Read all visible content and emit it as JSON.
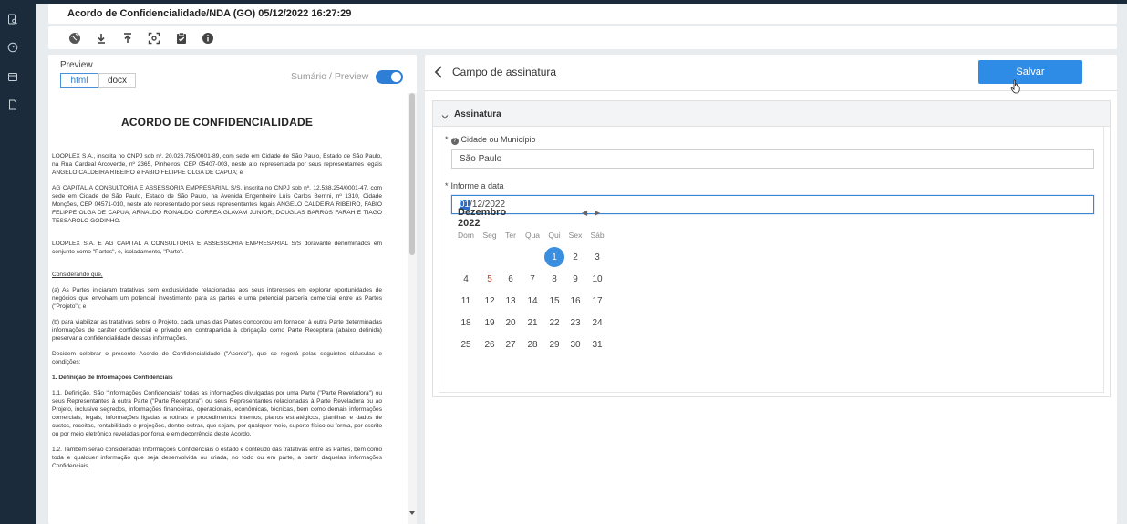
{
  "document": {
    "title": "Acordo de Confidencialidade/NDA (GO) 05/12/2022 16:27:29"
  },
  "toolbar": {
    "icons": [
      "globe-icon",
      "download-icon",
      "upload-icon",
      "scan-icon",
      "clipboard-check-icon",
      "info-icon"
    ]
  },
  "preview": {
    "label": "Preview",
    "tabs": [
      {
        "label": "html",
        "active": true
      },
      {
        "label": "docx",
        "active": false
      }
    ],
    "toggle_label": "Sumário / Preview",
    "toggle_on": true,
    "heading": "ACORDO DE CONFIDENCIALIDADE",
    "paragraphs": {
      "p1": "LOOPLEX S.A., inscrita no CNPJ sob nº. 20.026.785/0001-89, com sede em Cidade de São Paulo, Estado de São Paulo, na Rua Cardeal Arcoverde, nº 2365, Pinheiros, CEP 05407-003, neste ato representada por seus representantes legais ANGELO CALDEIRA RIBEIRO e FABIO FELIPPE OLGA DE CAPUA; e",
      "p2": "AG CAPITAL A CONSULTORIA E ASSESSORIA EMPRESARIAL S/S, inscrita no CNPJ sob nº. 12.538.254/0001-47, com sede em Cidade de São Paulo, Estado de São Paulo, na Avenida Engenheiro Luís Carlos Berrini, nº 1310, Cidade Monções, CEP 04571-010, neste ato representado por seus representantes legais ANGELO CALDEIRA RIBEIRO, FABIO FELIPPE OLGA DE CAPUA, ARNALDO RONALDO CORREA GLAVAM JUNIOR, DOUGLAS BARROS FARAH E TIAGO TESSAROLO GODINHO.",
      "p3": "LOOPLEX S.A. E AG CAPITAL A CONSULTORIA E ASSESSORIA EMPRESARIAL S/S doravante denominados em conjunto como \"Partes\", e, isoladamente, \"Parte\".",
      "p4": "Considerando que,",
      "p5": "(a) As Partes iniciaram tratativas sem exclusividade relacionadas aos seus interesses em explorar oportunidades de negócios que envolvam um potencial investimento para as partes e uma potencial parceria comercial entre as Partes (\"Projeto\"); e",
      "p6": "(b) para viabilizar as tratativas sobre o Projeto, cada umas das Partes concordou em fornecer à outra Parte determinadas informações de caráter confidencial e privado em contrapartida à obrigação como Parte Receptora (abaixo definida) preservar a confidencialidade dessas informações.",
      "p7": "Decidem celebrar o presente Acordo de Confidencialidade (\"Acordo\"), que se regerá pelas seguintes cláusulas e condições:",
      "p8": "1. Definição de Informações Confidenciais",
      "p9": "1.1.   Definição. São \"Informações Confidenciais\" todas as informações divulgadas por uma Parte (\"Parte Reveladora\") ou seus Representantes à outra Parte (\"Parte Receptora\") ou seus Representantes relacionadas à Parte Reveladora ou ao Projeto, inclusive segredos, informações financeiras, operacionais, econômicas, técnicas, bem como demais informações comerciais, legais, informações ligadas a rotinas e procedimentos internos, planos estratégicos, planilhas e dados de custos, receitas, rentabilidade e projeções, dentre outras, que sejam, por qualquer meio, suporte físico ou forma, por escrito ou por meio eletrônico reveladas por força e em decorrência deste Acordo.",
      "p10": "1.2.   Também serão consideradas Informações Confidenciais o estado e conteúdo das tratativas entre as Partes, bem como toda e qualquer informação que seja desenvolvida ou criada, no todo ou em parte, a partir daquelas informações Confidenciais."
    }
  },
  "field_panel": {
    "title": "Campo de assinatura",
    "save_label": "Salvar",
    "section_title": "Assinatura",
    "city": {
      "required_mark": "*",
      "label": "Cidade ou Município",
      "value": "São Paulo"
    },
    "date": {
      "required_mark": "*",
      "label": "Informe a data",
      "value_selected": "01",
      "value_rest": "/12/2022"
    },
    "calendar": {
      "month": "Dezembro 2022",
      "prev_icon": "◀",
      "next_icon": "▶",
      "weekdays": [
        "Dom",
        "Seg",
        "Ter",
        "Qua",
        "Qui",
        "Sex",
        "Sáb"
      ],
      "selected_day": "1",
      "holiday_day": "5",
      "weeks": [
        [
          "",
          "",
          "",
          "",
          "1",
          "2",
          "3"
        ],
        [
          "4",
          "5",
          "6",
          "7",
          "8",
          "9",
          "10"
        ],
        [
          "11",
          "12",
          "13",
          "14",
          "15",
          "16",
          "17"
        ],
        [
          "18",
          "19",
          "20",
          "21",
          "22",
          "23",
          "24"
        ],
        [
          "25",
          "26",
          "27",
          "28",
          "29",
          "30",
          "31"
        ]
      ]
    }
  },
  "colors": {
    "sidebar": "#1c2b3c",
    "accent": "#2e8ce6",
    "selected_day": "#3a8ee0",
    "holiday": "#c0392b"
  }
}
